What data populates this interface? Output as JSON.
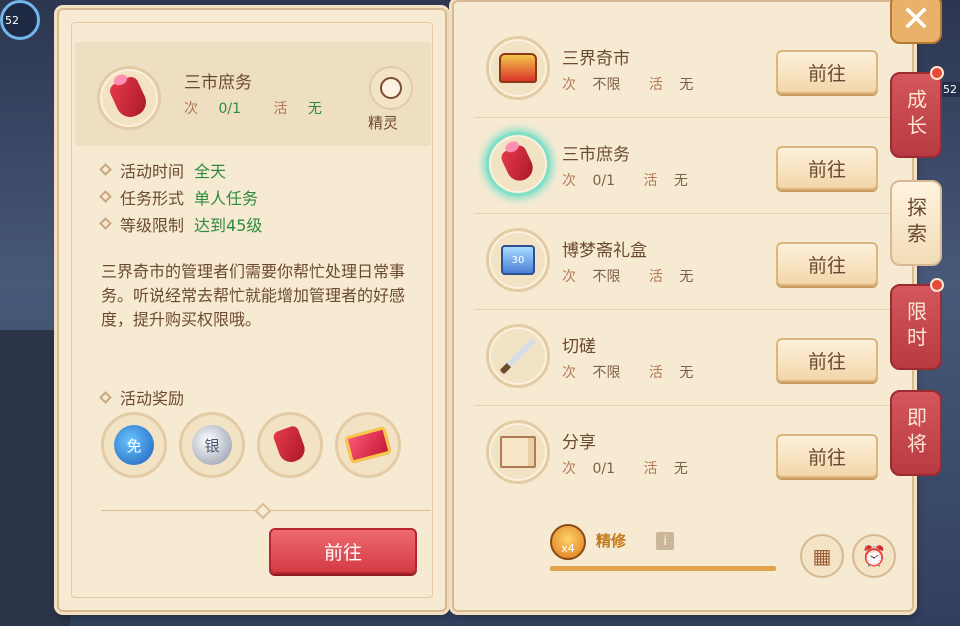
{
  "background": {
    "level_badge": "52",
    "side_number": "52"
  },
  "detail": {
    "title": "三市庶务",
    "times_label": "次",
    "times_value": "0/1",
    "active_label": "活",
    "active_value": "无",
    "spirit_label": "精灵",
    "info": [
      {
        "label": "活动时间",
        "value": "全天"
      },
      {
        "label": "任务形式",
        "value": "单人任务"
      },
      {
        "label": "等级限制",
        "value": "达到45级"
      }
    ],
    "description": "三界奇市的管理者们需要你帮忙处理日常事务。听说经常去帮忙就能增加管理者的好感度，提升购买权限哦。",
    "rewards_title": "活动奖励",
    "rewards": [
      {
        "icon": "blue-coin-icon",
        "text": "免"
      },
      {
        "icon": "silver-coin-icon",
        "text": "银"
      },
      {
        "icon": "red-pouch-icon",
        "text": ""
      },
      {
        "icon": "red-ticket-icon",
        "text": ""
      }
    ],
    "go_label": "前往"
  },
  "activities": [
    {
      "name": "三界奇市",
      "times_label": "次",
      "times_value": "不限",
      "active_label": "活",
      "active_value": "无",
      "icon": "treasure-chest-icon",
      "selected": false,
      "go_label": "前往"
    },
    {
      "name": "三市庶务",
      "times_label": "次",
      "times_value": "0/1",
      "active_label": "活",
      "active_value": "无",
      "icon": "red-pouch-icon",
      "selected": true,
      "go_label": "前往"
    },
    {
      "name": "博梦斋礼盒",
      "times_label": "次",
      "times_value": "不限",
      "active_label": "活",
      "active_value": "无",
      "icon": "gift-box-icon",
      "selected": false,
      "go_label": "前往"
    },
    {
      "name": "切磋",
      "times_label": "次",
      "times_value": "不限",
      "active_label": "活",
      "active_value": "无",
      "icon": "sword-icon",
      "selected": false,
      "go_label": "前往"
    },
    {
      "name": "分享",
      "times_label": "次",
      "times_value": "0/1",
      "active_label": "活",
      "active_value": "无",
      "icon": "book-icon",
      "selected": false,
      "go_label": "前往"
    }
  ],
  "cultivation": {
    "badge": "x4",
    "label": "精修",
    "info": "i",
    "progress": 1.0
  },
  "side_tabs": [
    {
      "label": "成长",
      "active": false,
      "dot": true
    },
    {
      "label": "探索",
      "active": true,
      "dot": false
    },
    {
      "label": "限时",
      "active": false,
      "dot": true
    },
    {
      "label": "即将",
      "active": false,
      "dot": false
    }
  ],
  "close_label": "✕",
  "icons": {
    "calendar": "calendar-icon",
    "alarm": "alarm-clock-icon"
  },
  "colors": {
    "green_value": "#2e8b3e",
    "panel": "#f7ead2",
    "go_red": "#d43b44",
    "tab_red": "#b83a42"
  }
}
